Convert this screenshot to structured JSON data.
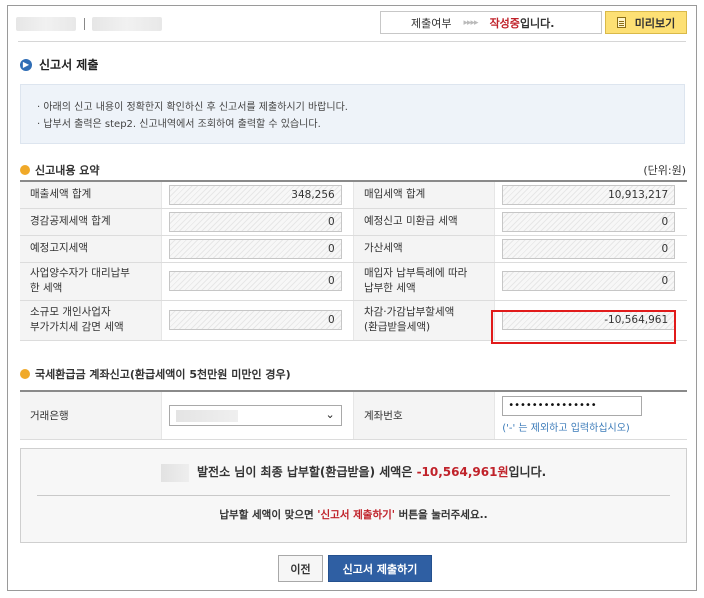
{
  "header": {
    "status_label": "제출여부",
    "status_arrows": "▸▸▸▸",
    "status_value": "작성중",
    "status_suffix": "입니다.",
    "preview_button": "미리보기"
  },
  "page_title": "신고서 제출",
  "notice": {
    "lines": [
      "· 아래의 신고 내용이 정확한지 확인하신 후 신고서를 제출하시기 바랍니다.",
      "· 납부서 출력은 step2. 신고내역에서 조회하여 출력할 수 있습니다."
    ]
  },
  "summary": {
    "heading": "신고내용 요약",
    "unit": "(단위:원)",
    "rows": [
      {
        "l1": "매출세액 합계",
        "v1": "348,256",
        "l2": "매입세액 합계",
        "v2": "10,913,217"
      },
      {
        "l1": "경감공제세액 합계",
        "v1": "0",
        "l2": "예정신고 미환급 세액",
        "v2": "0"
      },
      {
        "l1": "예정고지세액",
        "v1": "0",
        "l2": "가산세액",
        "v2": "0"
      },
      {
        "l1": "사업양수자가 대리납부\n한 세액",
        "v1": "0",
        "l2": "매입자 납부특례에 따라\n납부한 세액",
        "v2": "0"
      },
      {
        "l1": "소규모 개인사업자\n부가가치세 감면 세액",
        "v1": "0",
        "l2": "차감·가감납부할세액\n(환급받을세액)",
        "v2": "-10,564,961"
      }
    ]
  },
  "account": {
    "heading": "국세환급금 계좌신고(환급세액이 5천만원 미만인 경우)",
    "bank_label": "거래은행",
    "account_label": "계좌번호",
    "account_value": "•••••••••••••••",
    "account_hint": "('-' 는 제외하고 입력하십시오)"
  },
  "result": {
    "name_suffix": "발전소 님이 최종 납부할(환급받을) 세액은",
    "amount": "-10,564,961원",
    "end": "입니다.",
    "prompt_pre": "납부할 세액이 맞으면 ",
    "prompt_quote": "'신고서 제출하기'",
    "prompt_post": " 버튼을 눌러주세요.."
  },
  "buttons": {
    "prev": "이전",
    "submit": "신고서 제출하기"
  },
  "colors": {
    "accent_blue": "#2f5fa3",
    "status_red": "#c0222a",
    "highlight_red": "#e11b1b",
    "preview_yellow": "#fde074"
  }
}
